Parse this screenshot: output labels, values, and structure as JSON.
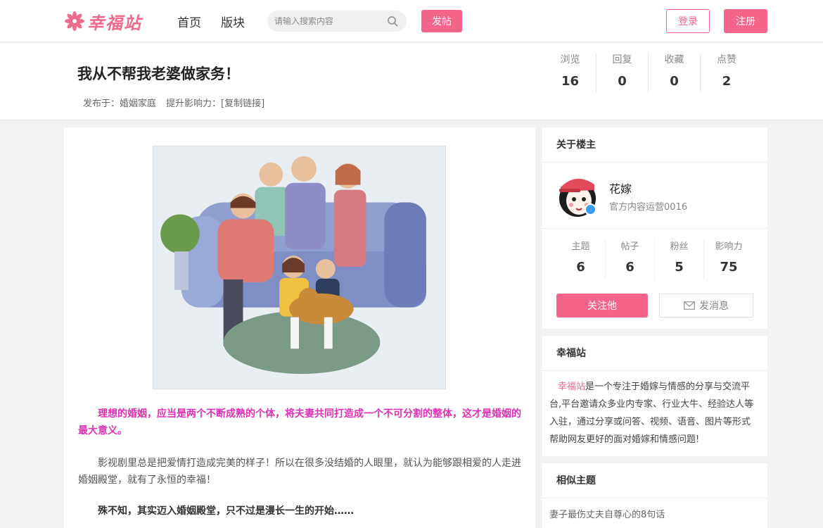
{
  "nav": {
    "logo_text": "幸福站",
    "links": [
      "首页",
      "版块"
    ],
    "search_placeholder": "请输入搜索内容",
    "post_label": "发帖",
    "login_label": "登录",
    "register_label": "注册"
  },
  "post": {
    "title": "我从不帮我老婆做家务！",
    "meta_prefix": "发布于：",
    "category": "婚姻家庭",
    "influence_label": "提升影响力：",
    "copy_link": "[复制链接]",
    "stats": [
      {
        "label": "浏览",
        "value": "16"
      },
      {
        "label": "回复",
        "value": "0"
      },
      {
        "label": "收藏",
        "value": "0"
      },
      {
        "label": "点赞",
        "value": "2"
      }
    ],
    "paragraphs": {
      "highlight": "理想的婚姻，应当是两个不断成熟的个体，将夫妻共同打造成一个不可分割的整体，这才是婚姻的最大意义。",
      "normal": "影视剧里总是把爱情打造成完美的样子！所以在很多没结婚的人眼里，就认为能够跟相爱的人走进婚姻殿堂，就有了永恒的幸福！",
      "bold": "殊不知，其实迈入婚姻殿堂，只不过是漫长一生的开始……"
    }
  },
  "sidebar": {
    "author": {
      "heading": "关于楼主",
      "name": "花嫁",
      "role": "官方内容运营0016",
      "stats": [
        {
          "label": "主题",
          "value": "6"
        },
        {
          "label": "帖子",
          "value": "6"
        },
        {
          "label": "粉丝",
          "value": "5"
        },
        {
          "label": "影响力",
          "value": "75"
        }
      ],
      "follow_label": "关注他",
      "message_label": "发消息"
    },
    "about": {
      "heading": "幸福站",
      "brand": "幸福站",
      "text": "是一个专注于婚嫁与情感的分享与交流平台,平台邀请众多业内专家、行业大牛、经验达人等入驻，通过分享或问答、视频、语音、图片等形式帮助网友更好的面对婚嫁和情感问题!"
    },
    "similar": {
      "heading": "相似主题",
      "items": [
        "妻子最伤丈夫自尊心的8句话"
      ]
    }
  },
  "colors": {
    "accent": "#f5658a",
    "highlight_text": "#e02fb4",
    "verified": "#3a9cf0"
  }
}
